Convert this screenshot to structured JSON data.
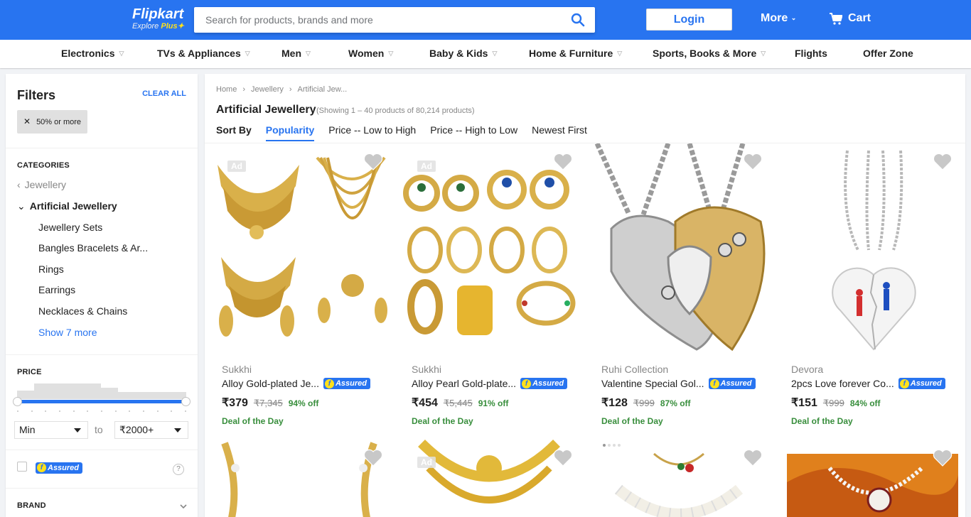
{
  "header": {
    "logo": "Flipkart",
    "logo_sub_prefix": "Explore ",
    "logo_sub_plus": "Plus",
    "search_placeholder": "Search for products, brands and more",
    "login": "Login",
    "more": "More",
    "cart": "Cart",
    "brand_color": "#2874f0"
  },
  "nav": [
    {
      "label": "Electronics",
      "chevron": true
    },
    {
      "label": "TVs & Appliances",
      "chevron": true
    },
    {
      "label": "Men",
      "chevron": true
    },
    {
      "label": "Women",
      "chevron": true
    },
    {
      "label": "Baby & Kids",
      "chevron": true
    },
    {
      "label": "Home & Furniture",
      "chevron": true
    },
    {
      "label": "Sports, Books & More",
      "chevron": true
    },
    {
      "label": "Flights",
      "chevron": false
    },
    {
      "label": "Offer Zone",
      "chevron": false
    }
  ],
  "filters": {
    "title": "Filters",
    "clear_all": "CLEAR ALL",
    "chip": "50% or more",
    "categories_title": "CATEGORIES",
    "parent": "Jewellery",
    "active": "Artificial Jewellery",
    "subcategories": [
      "Jewellery Sets",
      "Bangles Bracelets & Ar...",
      "Rings",
      "Earrings",
      "Necklaces & Chains"
    ],
    "show_more": "Show 7 more",
    "price_title": "PRICE",
    "min": "Min",
    "to": "to",
    "max": "₹2000+",
    "assured_label": "Assured",
    "help": "?",
    "brand_title": "BRAND"
  },
  "main": {
    "breadcrumbs": [
      "Home",
      "Jewellery",
      "Artificial Jew..."
    ],
    "title": "Artificial Jewellery",
    "showing": "(Showing 1 – 40 products of 80,214 products)",
    "sort_label": "Sort By",
    "sort_options": [
      "Popularity",
      "Price -- Low to High",
      "Price -- High to Low",
      "Newest First"
    ],
    "active_sort": "Popularity",
    "ad_label": "Ad"
  },
  "products": [
    {
      "brand": "Sukkhi",
      "name": "Alloy Gold-plated Je...",
      "price": "₹379",
      "mrp": "₹7,345",
      "off": "94% off",
      "deal": "Deal of the Day",
      "ad": true,
      "assured": true
    },
    {
      "brand": "Sukkhi",
      "name": "Alloy Pearl Gold-plate...",
      "price": "₹454",
      "mrp": "₹5,445",
      "off": "91% off",
      "deal": "Deal of the Day",
      "ad": true,
      "assured": true
    },
    {
      "brand": "Ruhi Collection",
      "name": "Valentine Special Gol...",
      "price": "₹128",
      "mrp": "₹999",
      "off": "87% off",
      "deal": "Deal of the Day",
      "ad": false,
      "assured": true
    },
    {
      "brand": "Devora",
      "name": "2pcs Love forever Co...",
      "price": "₹151",
      "mrp": "₹999",
      "off": "84% off",
      "deal": "Deal of the Day",
      "ad": false,
      "assured": true
    }
  ],
  "product_row2": [
    {
      "ad": false
    },
    {
      "ad": true
    },
    {
      "ad": false
    },
    {
      "ad": false
    }
  ],
  "colors": {
    "accent": "#2874f0",
    "discount": "#388e3c",
    "assured_yellow": "#ffe11b"
  },
  "icons": [
    "search-icon",
    "cart-icon",
    "heart-icon",
    "chevron-down-icon",
    "chevron-left-icon",
    "close-icon"
  ]
}
